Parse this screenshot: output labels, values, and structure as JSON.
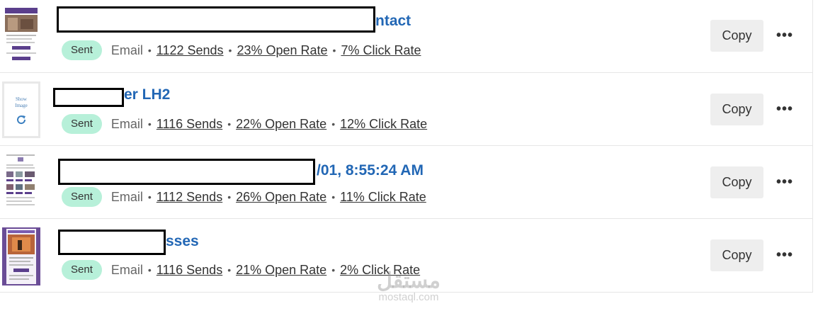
{
  "campaigns": [
    {
      "title_visible": "ntact",
      "status": "Sent",
      "type": "Email",
      "sends": "1122 Sends",
      "open_rate": "23% Open Rate",
      "click_rate": "7% Click Rate",
      "copy_label": "Copy",
      "more_label": "•••"
    },
    {
      "title_visible": "er LH2",
      "thumbnail_text": "Show Image",
      "status": "Sent",
      "type": "Email",
      "sends": "1116 Sends",
      "open_rate": "22% Open Rate",
      "click_rate": "12% Click Rate",
      "copy_label": "Copy",
      "more_label": "•••"
    },
    {
      "title_visible": "/01, 8:55:24 AM",
      "status": "Sent",
      "type": "Email",
      "sends": "1112 Sends",
      "open_rate": "26% Open Rate",
      "click_rate": "11% Click Rate",
      "copy_label": "Copy",
      "more_label": "•••"
    },
    {
      "title_visible": "sses",
      "status": "Sent",
      "type": "Email",
      "sends": "1116 Sends",
      "open_rate": "21% Open Rate",
      "click_rate": "2% Click Rate",
      "copy_label": "Copy",
      "more_label": "•••"
    }
  ],
  "separator": "•",
  "watermark": {
    "arabic": "مستقل",
    "latin": "mostaql.com"
  },
  "colors": {
    "title": "#2267b5",
    "badge_bg": "#b7f0d9",
    "button_bg": "#eeeeee",
    "divider": "#e6e6e6"
  }
}
